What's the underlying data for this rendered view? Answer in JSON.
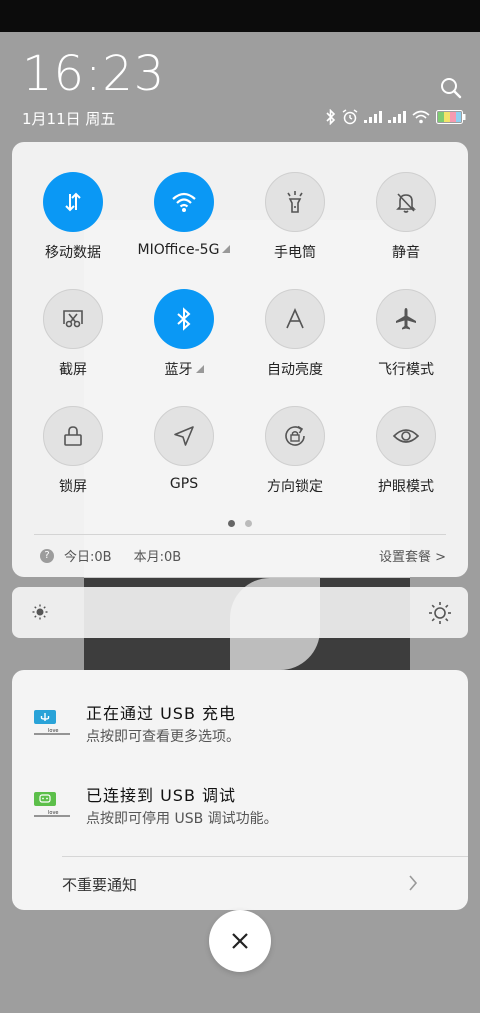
{
  "status": {
    "time": "16:23",
    "date": "1月11日 周五"
  },
  "quick_settings": {
    "tiles": [
      {
        "label": "移动数据",
        "state": "on",
        "icon": "mobile-data-icon"
      },
      {
        "label": "MIOffice-5G",
        "state": "on",
        "icon": "wifi-icon"
      },
      {
        "label": "手电筒",
        "state": "off",
        "icon": "flashlight-icon"
      },
      {
        "label": "静音",
        "state": "off",
        "icon": "mute-bell-icon"
      },
      {
        "label": "截屏",
        "state": "off",
        "icon": "screenshot-icon"
      },
      {
        "label": "蓝牙",
        "state": "on",
        "icon": "bluetooth-icon"
      },
      {
        "label": "自动亮度",
        "state": "off",
        "icon": "auto-brightness-icon"
      },
      {
        "label": "飞行模式",
        "state": "off",
        "icon": "airplane-icon"
      },
      {
        "label": "锁屏",
        "state": "off",
        "icon": "lock-icon"
      },
      {
        "label": "GPS",
        "state": "off",
        "icon": "gps-icon"
      },
      {
        "label": "方向锁定",
        "state": "off",
        "icon": "rotation-lock-icon"
      },
      {
        "label": "护眼模式",
        "state": "off",
        "icon": "eye-icon"
      }
    ],
    "page_count": 2,
    "active_page": 1,
    "usage_help": "?",
    "usage_today": "今日:0B",
    "usage_month": "本月:0B",
    "plan_link": "设置套餐 >"
  },
  "notifications": [
    {
      "title": "正在通过 USB 充电",
      "subtitle": "点按即可查看更多选项。",
      "icon": "usb-charging-icon"
    },
    {
      "title": "已连接到 USB 调试",
      "subtitle": "点按即可停用 USB 调试功能。",
      "icon": "usb-debug-icon"
    }
  ],
  "unimportant_label": "不重要通知",
  "colors": {
    "accent": "#0a98f5",
    "tile_off": "#e2e2e2"
  }
}
